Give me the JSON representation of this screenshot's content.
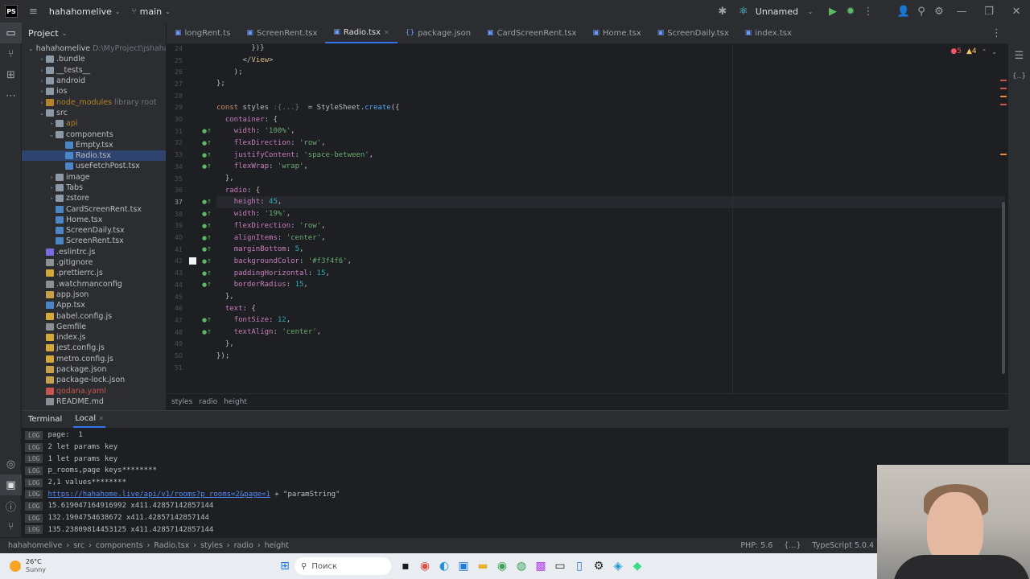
{
  "titlebar": {
    "project": "hahahomelive",
    "branch": "main",
    "run_config": "Unnamed"
  },
  "project_panel": {
    "title": "Project",
    "tree": [
      {
        "label": "hahahomelive",
        "extra": "D:\\MyProject\\jshaha",
        "depth": 0,
        "arrow": "v",
        "kind": "folder"
      },
      {
        "label": ".bundle",
        "depth": 1,
        "arrow": ">",
        "kind": "folder"
      },
      {
        "label": "__tests__",
        "depth": 1,
        "arrow": ">",
        "kind": "folder"
      },
      {
        "label": "android",
        "depth": 1,
        "arrow": ">",
        "kind": "folder"
      },
      {
        "label": "ios",
        "depth": 1,
        "arrow": ">",
        "kind": "folder"
      },
      {
        "label": "node_modules",
        "extra": "library root",
        "depth": 1,
        "arrow": ">",
        "kind": "excluded"
      },
      {
        "label": "src",
        "depth": 1,
        "arrow": "v",
        "kind": "folder"
      },
      {
        "label": "api",
        "depth": 2,
        "arrow": ">",
        "kind": "folder-dim"
      },
      {
        "label": "components",
        "depth": 2,
        "arrow": "v",
        "kind": "folder"
      },
      {
        "label": "Empty.tsx",
        "depth": 3,
        "arrow": "",
        "kind": "tsx"
      },
      {
        "label": "Radio.tsx",
        "depth": 3,
        "arrow": "",
        "kind": "tsx",
        "selected": true
      },
      {
        "label": "useFetchPost.tsx",
        "depth": 3,
        "arrow": "",
        "kind": "tsx"
      },
      {
        "label": "image",
        "depth": 2,
        "arrow": ">",
        "kind": "folder"
      },
      {
        "label": "Tabs",
        "depth": 2,
        "arrow": ">",
        "kind": "folder"
      },
      {
        "label": "zstore",
        "depth": 2,
        "arrow": ">",
        "kind": "folder"
      },
      {
        "label": "CardScreenRent.tsx",
        "depth": 2,
        "arrow": "",
        "kind": "tsx"
      },
      {
        "label": "Home.tsx",
        "depth": 2,
        "arrow": "",
        "kind": "tsx"
      },
      {
        "label": "ScreenDaily.tsx",
        "depth": 2,
        "arrow": "",
        "kind": "tsx"
      },
      {
        "label": "ScreenRent.tsx",
        "depth": 2,
        "arrow": "",
        "kind": "tsx"
      },
      {
        "label": ".eslintrc.js",
        "depth": 1,
        "arrow": "",
        "kind": "eslint"
      },
      {
        "label": ".gitignore",
        "depth": 1,
        "arrow": "",
        "kind": "plain"
      },
      {
        "label": ".prettierrc.js",
        "depth": 1,
        "arrow": "",
        "kind": "js"
      },
      {
        "label": ".watchmanconfig",
        "depth": 1,
        "arrow": "",
        "kind": "plain"
      },
      {
        "label": "app.json",
        "depth": 1,
        "arrow": "",
        "kind": "json"
      },
      {
        "label": "App.tsx",
        "depth": 1,
        "arrow": "",
        "kind": "tsx"
      },
      {
        "label": "babel.config.js",
        "depth": 1,
        "arrow": "",
        "kind": "js"
      },
      {
        "label": "Gemfile",
        "depth": 1,
        "arrow": "",
        "kind": "plain"
      },
      {
        "label": "index.js",
        "depth": 1,
        "arrow": "",
        "kind": "js"
      },
      {
        "label": "jest.config.js",
        "depth": 1,
        "arrow": "",
        "kind": "js"
      },
      {
        "label": "metro.config.js",
        "depth": 1,
        "arrow": "",
        "kind": "js"
      },
      {
        "label": "package.json",
        "depth": 1,
        "arrow": "",
        "kind": "json"
      },
      {
        "label": "package-lock.json",
        "depth": 1,
        "arrow": "",
        "kind": "json"
      },
      {
        "label": "qodana.yaml",
        "depth": 1,
        "arrow": "",
        "kind": "yaml"
      },
      {
        "label": "README.md",
        "depth": 1,
        "arrow": "",
        "kind": "plain"
      }
    ]
  },
  "tabs": [
    {
      "label": "longRent.ts",
      "active": false
    },
    {
      "label": "ScreenRent.tsx",
      "active": false
    },
    {
      "label": "Radio.tsx",
      "active": true
    },
    {
      "label": "package.json",
      "active": false
    },
    {
      "label": "CardScreenRent.tsx",
      "active": false
    },
    {
      "label": "Home.tsx",
      "active": false
    },
    {
      "label": "ScreenDaily.tsx",
      "active": false
    },
    {
      "label": "index.tsx",
      "active": false
    }
  ],
  "inspections": {
    "errors": "5",
    "warnings": "4"
  },
  "editor": {
    "current_line": "36",
    "lines": [
      {
        "n": "24",
        "seg": [
          [
            "w",
            "        })}"
          ]
        ]
      },
      {
        "n": "25",
        "seg": [
          [
            "w",
            "      </"
          ],
          [
            "t",
            "View"
          ],
          [
            "w",
            ">"
          ]
        ]
      },
      {
        "n": "26",
        "seg": [
          [
            "w",
            "    );"
          ]
        ]
      },
      {
        "n": "27",
        "seg": [
          [
            "w",
            "};"
          ]
        ]
      },
      {
        "n": "28",
        "seg": []
      },
      {
        "n": "29",
        "seg": [
          [
            "k",
            "const "
          ],
          [
            "w",
            "styles "
          ],
          [
            "g",
            ":{...} "
          ],
          [
            "w",
            " = StyleSheet."
          ],
          [
            "f",
            "create"
          ],
          [
            "w",
            "({"
          ]
        ]
      },
      {
        "n": "30",
        "seg": [
          [
            "w",
            "  "
          ],
          [
            "p",
            "container"
          ],
          [
            "w",
            ": {"
          ]
        ]
      },
      {
        "n": "31",
        "mark": true,
        "seg": [
          [
            "w",
            "    "
          ],
          [
            "p",
            "width"
          ],
          [
            "w",
            ": "
          ],
          [
            "s",
            "'100%'"
          ],
          [
            "w",
            ","
          ]
        ]
      },
      {
        "n": "32",
        "mark": true,
        "seg": [
          [
            "w",
            "    "
          ],
          [
            "p",
            "flexDirection"
          ],
          [
            "w",
            ": "
          ],
          [
            "s",
            "'row'"
          ],
          [
            "w",
            ","
          ]
        ]
      },
      {
        "n": "33",
        "mark": true,
        "seg": [
          [
            "w",
            "    "
          ],
          [
            "p",
            "justifyContent"
          ],
          [
            "w",
            ": "
          ],
          [
            "s",
            "'space-between'"
          ],
          [
            "w",
            ","
          ]
        ]
      },
      {
        "n": "34",
        "mark": true,
        "seg": [
          [
            "w",
            "    "
          ],
          [
            "p",
            "flexWrap"
          ],
          [
            "w",
            ": "
          ],
          [
            "s",
            "'wrap'"
          ],
          [
            "w",
            ","
          ]
        ]
      },
      {
        "n": "35",
        "seg": [
          [
            "w",
            "  },"
          ]
        ]
      },
      {
        "n": "36",
        "seg": [
          [
            "w",
            "  "
          ],
          [
            "p",
            "radio"
          ],
          [
            "w",
            ": {"
          ]
        ]
      },
      {
        "n": "37",
        "mark": true,
        "cur": true,
        "seg": [
          [
            "w",
            "    "
          ],
          [
            "p",
            "height"
          ],
          [
            "w",
            ": "
          ],
          [
            "n",
            "45"
          ],
          [
            "w",
            ","
          ]
        ]
      },
      {
        "n": "38",
        "mark": true,
        "seg": [
          [
            "w",
            "    "
          ],
          [
            "p",
            "width"
          ],
          [
            "w",
            ": "
          ],
          [
            "s",
            "'19%'"
          ],
          [
            "w",
            ","
          ]
        ]
      },
      {
        "n": "39",
        "mark": true,
        "seg": [
          [
            "w",
            "    "
          ],
          [
            "p",
            "flexDirection"
          ],
          [
            "w",
            ": "
          ],
          [
            "s",
            "'row'"
          ],
          [
            "w",
            ","
          ]
        ]
      },
      {
        "n": "40",
        "mark": true,
        "seg": [
          [
            "w",
            "    "
          ],
          [
            "p",
            "alignItems"
          ],
          [
            "w",
            ": "
          ],
          [
            "s",
            "'center'"
          ],
          [
            "w",
            ","
          ]
        ]
      },
      {
        "n": "41",
        "mark": true,
        "seg": [
          [
            "w",
            "    "
          ],
          [
            "p",
            "marginBottom"
          ],
          [
            "w",
            ": "
          ],
          [
            "n",
            "5"
          ],
          [
            "w",
            ","
          ]
        ]
      },
      {
        "n": "42",
        "mark": true,
        "swatch": true,
        "seg": [
          [
            "w",
            "    "
          ],
          [
            "p",
            "backgroundColor"
          ],
          [
            "w",
            ": "
          ],
          [
            "s",
            "'#f3f4f6'"
          ],
          [
            "w",
            ","
          ]
        ]
      },
      {
        "n": "43",
        "mark": true,
        "seg": [
          [
            "w",
            "    "
          ],
          [
            "p",
            "paddingHorizontal"
          ],
          [
            "w",
            ": "
          ],
          [
            "n",
            "15"
          ],
          [
            "w",
            ","
          ]
        ]
      },
      {
        "n": "44",
        "mark": true,
        "seg": [
          [
            "w",
            "    "
          ],
          [
            "p",
            "borderRadius"
          ],
          [
            "w",
            ": "
          ],
          [
            "n",
            "15"
          ],
          [
            "w",
            ","
          ]
        ]
      },
      {
        "n": "45",
        "seg": [
          [
            "w",
            "  },"
          ]
        ]
      },
      {
        "n": "46",
        "seg": [
          [
            "w",
            "  "
          ],
          [
            "p",
            "text"
          ],
          [
            "w",
            ": {"
          ]
        ]
      },
      {
        "n": "47",
        "mark": true,
        "seg": [
          [
            "w",
            "    "
          ],
          [
            "p",
            "fontSize"
          ],
          [
            "w",
            ": "
          ],
          [
            "n",
            "12"
          ],
          [
            "w",
            ","
          ]
        ]
      },
      {
        "n": "48",
        "mark": true,
        "seg": [
          [
            "w",
            "    "
          ],
          [
            "p",
            "textAlign"
          ],
          [
            "w",
            ": "
          ],
          [
            "s",
            "'center'"
          ],
          [
            "w",
            ","
          ]
        ]
      },
      {
        "n": "49",
        "seg": [
          [
            "w",
            "  },"
          ]
        ]
      },
      {
        "n": "50",
        "seg": [
          [
            "w",
            "});"
          ]
        ]
      },
      {
        "n": "51",
        "seg": []
      }
    ]
  },
  "breadcrumbs": [
    "styles",
    "radio",
    "height"
  ],
  "terminal": {
    "tabs": [
      "Terminal",
      "Local"
    ],
    "badge": "LOG",
    "lines": [
      {
        "text": "page:  1"
      },
      {
        "text": "2 let params key"
      },
      {
        "text": "1 let params key"
      },
      {
        "text": "p_rooms,page keys********"
      },
      {
        "text": "2,1 values********"
      },
      {
        "link": "https://hahahome.live/api/v1/rooms?p_rooms=2&page=1",
        "text": " + \"paramString\""
      },
      {
        "text": "15.619047164916992 x411.42857142857144"
      },
      {
        "text": "132.1904754638672 x411.42857142857144"
      },
      {
        "text": "135.23809814453125 x411.42857142857144"
      }
    ]
  },
  "statusbar": {
    "path": [
      "hahahomelive",
      "src",
      "components",
      "Radio.tsx",
      "styles",
      "radio",
      "height"
    ],
    "php": "PHP: 5.6",
    "braces": "{...}",
    "ts": "TypeScript 5.0.4"
  },
  "taskbar": {
    "temp": "26°C",
    "weather": "Sunny",
    "search_placeholder": "Поиск"
  }
}
